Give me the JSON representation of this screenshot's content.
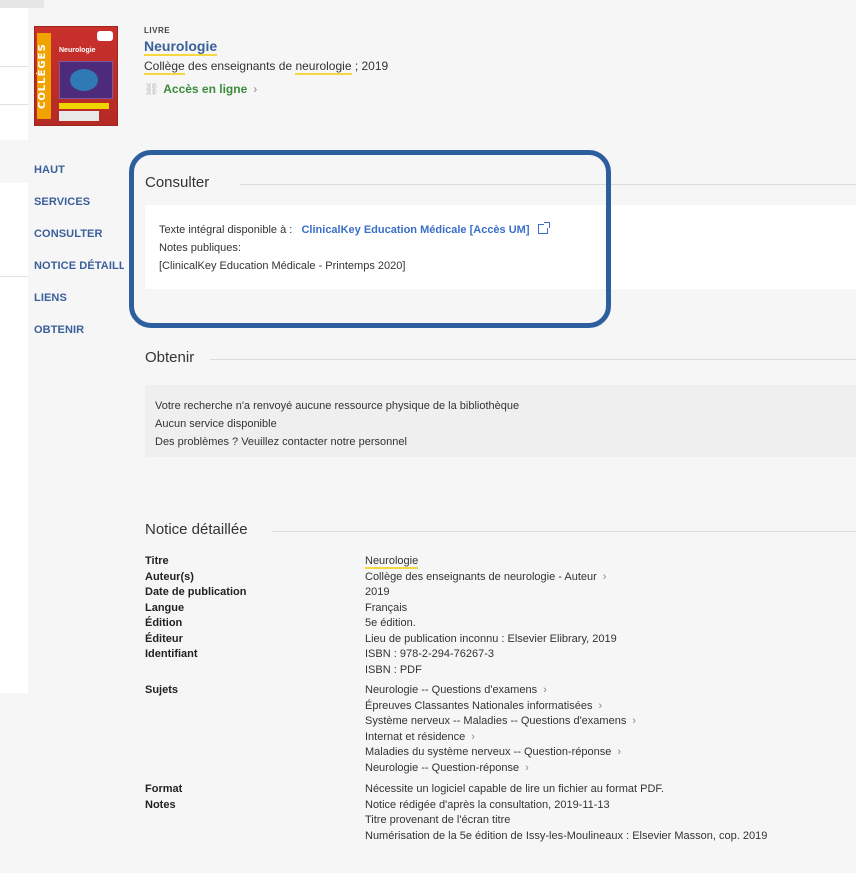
{
  "record": {
    "type": "LIVRE",
    "title": "Neurologie",
    "author_prefix": "Collège",
    "author_mid": " des enseignants de ",
    "author_hl": "neurologie",
    "author_suffix": " ; 2019",
    "online_access": "Accès en ligne",
    "cover": {
      "title": "Neurologie",
      "spine_text": "COLLÈGES"
    }
  },
  "nav": {
    "items": [
      "HAUT",
      "SERVICES",
      "CONSULTER",
      "NOTICE DÉTAILLÉE",
      "LIENS",
      "OBTENIR"
    ]
  },
  "consulter": {
    "title": "Consulter",
    "fulltext_label": "Texte intégral disponible à :",
    "fulltext_link": "ClinicalKey Education Médicale [Accès UM]",
    "notes_label": "Notes publiques:",
    "notes_value": "[ClinicalKey Education Médicale - Printemps 2020]"
  },
  "obtenir": {
    "title": "Obtenir",
    "lines": [
      "Votre recherche n'a renvoyé aucune ressource physique de la bibliothèque",
      "Aucun service disponible",
      "Des problèmes ? Veuillez contacter notre personnel"
    ]
  },
  "notice": {
    "title": "Notice détaillée",
    "rows": [
      {
        "label": "Titre",
        "values": [
          "Neurologie"
        ]
      },
      {
        "label": "Auteur(s)",
        "values": [
          "Collège des enseignants de neurologie - Auteur"
        ]
      },
      {
        "label": "Date de publication",
        "values": [
          "2019"
        ]
      },
      {
        "label": "Langue",
        "values": [
          "Français"
        ]
      },
      {
        "label": "Édition",
        "values": [
          "5e édition."
        ]
      },
      {
        "label": "Éditeur",
        "values": [
          "Lieu de publication inconnu : Elsevier Elibrary, 2019"
        ]
      },
      {
        "label": "Identifiant",
        "values": [
          "ISBN : 978-2-294-76267-3",
          "ISBN : PDF"
        ]
      },
      {
        "label": "Sujets",
        "values": [
          "Neurologie -- Questions d'examens",
          "Épreuves Classantes Nationales informatisées",
          "Système nerveux -- Maladies -- Questions d'examens",
          "Internat et résidence",
          "Maladies du système nerveux -- Question-réponse",
          "Neurologie -- Question-réponse"
        ]
      },
      {
        "label": "Format",
        "values": [
          "Nécessite un logiciel capable de lire un fichier au format PDF."
        ]
      },
      {
        "label": "Notes",
        "values": [
          "Notice rédigée d'après la consultation, 2019-11-13",
          "Titre provenant de l'écran titre",
          "Numérisation de la 5e édition de Issy-les-Moulineaux : Elsevier Masson, cop. 2019"
        ]
      }
    ]
  },
  "colors": {
    "accent": "#3a5f9a",
    "link": "#3a6fc9",
    "online": "#3c8a3c",
    "highlight": "#f7d740",
    "box": "#2d5f9e"
  }
}
